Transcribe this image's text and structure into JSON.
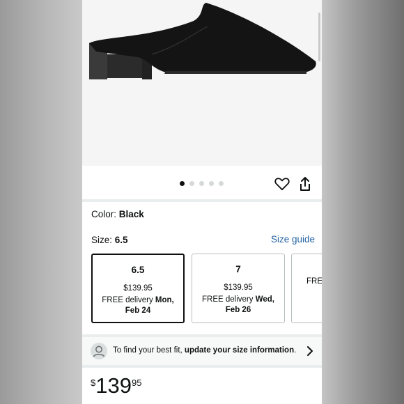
{
  "product": {
    "color_label": "Color: ",
    "color_value": "Black",
    "size_label": "Size: ",
    "size_value": "6.5",
    "size_guide": "Size guide",
    "carousel_count": 5,
    "carousel_active": 1
  },
  "sizes": [
    {
      "size": "6.5",
      "price": "$139.95",
      "delivery_prefix": "FREE delivery ",
      "delivery_date": "Mon, Feb 24",
      "selected": true
    },
    {
      "size": "7",
      "price": "$139.95",
      "delivery_prefix": "FREE delivery ",
      "delivery_date": "Wed, Feb 26",
      "selected": false
    },
    {
      "size": "",
      "price": "",
      "delivery_prefix": "FREE",
      "delivery_date": "",
      "selected": false
    }
  ],
  "fit_prompt": {
    "text": "To find your best fit, ",
    "link": "update your size information",
    "suffix": "."
  },
  "price": {
    "currency": "$",
    "whole": "139",
    "fraction": "95"
  },
  "icons": {
    "heart": "heart-icon",
    "share": "share-icon",
    "avatar": "user-avatar-icon",
    "chevron": "chevron-right-icon"
  },
  "colors": {
    "link": "#2162a1",
    "selected_border": "#0f1111"
  }
}
